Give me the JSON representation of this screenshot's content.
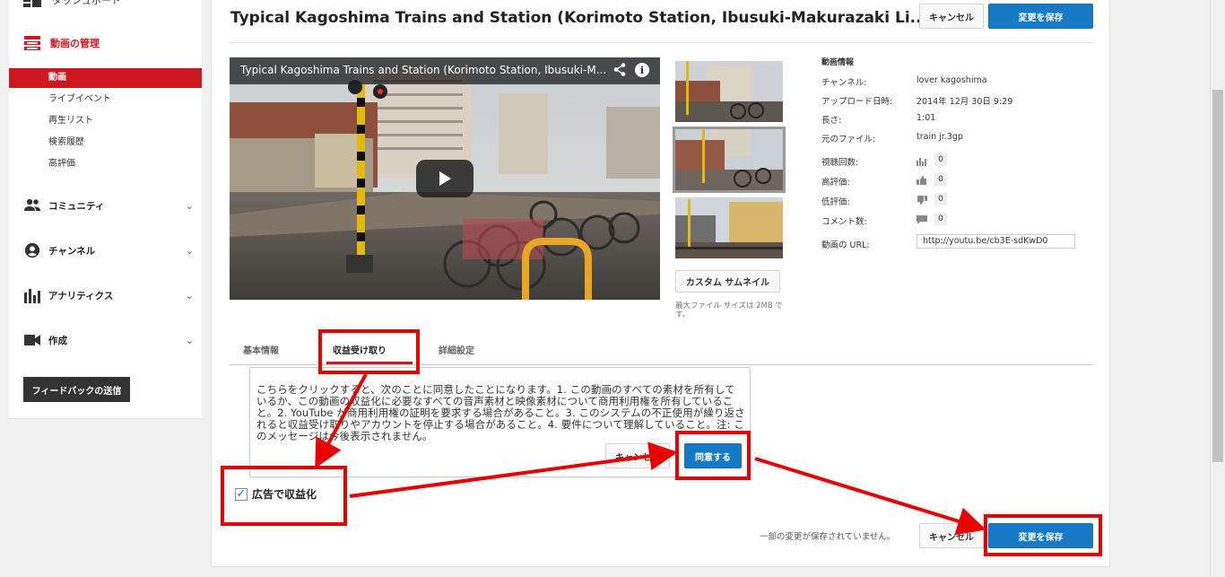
{
  "sidebar": {
    "top_item": "ダッシュボード",
    "manage_label": "動画の管理",
    "sub_items": [
      "動画",
      "ライブイベント",
      "再生リスト",
      "検索履歴",
      "高評価"
    ],
    "sections": [
      {
        "label": "コミュニティ",
        "icon": "people-icon"
      },
      {
        "label": "チャンネル",
        "icon": "account-icon"
      },
      {
        "label": "アナリティクス",
        "icon": "bar-chart-icon"
      },
      {
        "label": "作成",
        "icon": "video-camera-icon"
      }
    ],
    "feedback_label": "フィードバックの送信"
  },
  "header": {
    "title": "Typical Kagoshima Trains and Station (Korimoto Station, Ibusuki-Makurazaki Li...",
    "cancel_label": "キャンセル",
    "save_label": "変更を保存"
  },
  "player": {
    "title": "Typical Kagoshima Trains and Station (Korimoto Station, Ibusuki-M..."
  },
  "thumbnails": {
    "custom_label": "カスタム サムネイル",
    "max_size": "最大ファイル サイズは 2MB です。"
  },
  "video_info": {
    "heading": "動画情報",
    "channel_label": "チャンネル:",
    "channel_value": "lover kagoshima",
    "upload_label": "アップロード日時:",
    "upload_value": "2014年 12月 30日  9:29",
    "length_label": "長さ:",
    "length_value": "1:01",
    "file_label": "元のファイル:",
    "file_value": "train jr.3gp",
    "views_label": "視聴回数:",
    "views_value": "0",
    "likes_label": "高評価:",
    "likes_value": "0",
    "dislikes_label": "低評価:",
    "dislikes_value": "0",
    "comments_label": "コメント数:",
    "comments_value": "0",
    "url_label": "動画の URL:",
    "url_value": "http://youtu.be/cb3E-sdKwD0"
  },
  "tabs": [
    "基本情報",
    "収益受け取り",
    "詳細設定"
  ],
  "active_tab": "収益受け取り",
  "dialog": {
    "text": "こちらをクリックすると、次のことに同意したことになります。1. この動画のすべての素材を所有しているか、この動画の収益化に必要なすべての音声素材と映像素材について商用利用権を所有していること。2. YouTube が商用利用権の証明を要求する場合があること。3. このシステムの不正使用が繰り返されると収益受け取りやアカウントを停止する場合があること。4. 要件について理解していること。注: このメッセージは今後表示されません。",
    "cancel_label": "キャンセル",
    "agree_label": "同意する"
  },
  "monetize": {
    "label": "広告で収益化",
    "checked": true
  },
  "footer": {
    "unsaved_text": "一部の変更が保存されていません。",
    "cancel_label": "キャンセル",
    "save_label": "変更を保存"
  },
  "colors": {
    "accent_red": "#cc181e",
    "button_blue": "#167ac6",
    "annotation_red": "#e60000"
  }
}
